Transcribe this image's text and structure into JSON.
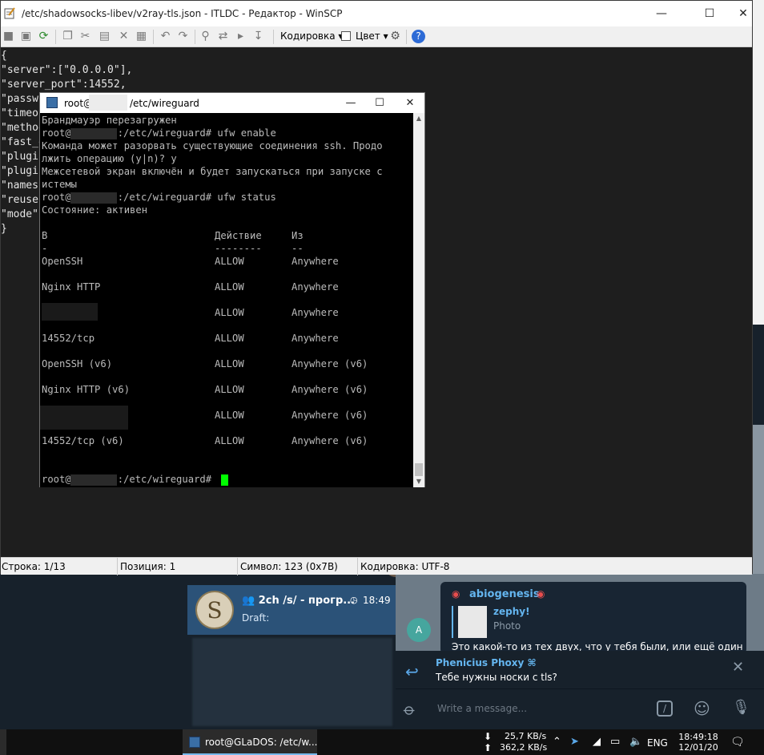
{
  "winscp": {
    "title": "/etc/shadowsocks-libev/v2ray-tls.json - ITLDC - Редактор - WinSCP",
    "toolbar": {
      "encoding_label": "Кодировка",
      "color_label": "Цвет"
    },
    "editor_lines": [
      "{",
      "\"server\":[\"0.0.0.0\"],",
      "\"server_port\":14552,",
      "\"passwo",
      "\"timeou",
      "\"method",
      "\"fast_o",
      "\"plugin",
      "\"plugin",
      "\"names",
      "\"reuse",
      "\"mode\"",
      "}"
    ],
    "status": {
      "line": "Строка: 1/13",
      "position": "Позиция: 1",
      "symbol": "Символ: 123 (0x7B)",
      "encoding": "Кодировка: UTF-8"
    }
  },
  "putty": {
    "title_prefix": "root@",
    "title_path": "/etc/wireguard",
    "prompt_user": "root@",
    "prompt_path": ":/etc/wireguard#",
    "lines": {
      "reload": "Брандмауэр перезагружен",
      "cmd_enable": " ufw enable",
      "warn1": "Команда может разорвать существующие соединения ssh. Продо",
      "warn2": "лжить операцию (y|n)? y",
      "enabled1": "Межсетевой экран включён и будет запускаться при запуске с",
      "enabled2": "истемы",
      "cmd_status": " ufw status",
      "state": "Состояние: активен"
    },
    "table": {
      "headers": [
        "В",
        "Действие",
        "Из"
      ],
      "dashes": [
        "-",
        "--------",
        "--"
      ],
      "rows": [
        {
          "to": "OpenSSH",
          "action": "ALLOW",
          "from": "Anywhere"
        },
        {
          "to": "Nginx HTTP",
          "action": "ALLOW",
          "from": "Anywhere"
        },
        {
          "to": "",
          "action": "ALLOW",
          "from": "Anywhere"
        },
        {
          "to": "14552/tcp",
          "action": "ALLOW",
          "from": "Anywhere"
        },
        {
          "to": "OpenSSH (v6)",
          "action": "ALLOW",
          "from": "Anywhere (v6)"
        },
        {
          "to": "Nginx HTTP (v6)",
          "action": "ALLOW",
          "from": "Anywhere (v6)"
        },
        {
          "to": "",
          "action": "ALLOW",
          "from": "Anywhere (v6)"
        },
        {
          "to": "14552/tcp (v6)",
          "action": "ALLOW",
          "from": "Anywhere (v6)"
        }
      ]
    }
  },
  "telegram": {
    "chat_title": "2ch /s/ - прогр...",
    "chat_time": "18:49",
    "chat_draft": "Draft:",
    "chat_avatar_letter": "S",
    "msg_author": "abiogenesis",
    "reply_name": "zephy!",
    "reply_type": "Photo",
    "msg_text": "Это какой-то из тех двух, что у тебя были, или ещё один",
    "msg_avatar_letter": "A",
    "replybox_name": "Phenicius Phoxy ⌘",
    "replybox_text": "Тебе нужны носки с tls?",
    "input_placeholder": "Write a message...",
    "colors": {
      "accent": "#64b5ef",
      "active_chat": "#2b5278",
      "bg": "#17212b"
    }
  },
  "taskbar": {
    "task_label": "root@GLaDOS: /etc/w...",
    "net_down": "25,7 KB/s",
    "net_up": "362,2 KB/s",
    "lang": "ENG",
    "time": "18:49:18",
    "date": "12/01/20"
  }
}
